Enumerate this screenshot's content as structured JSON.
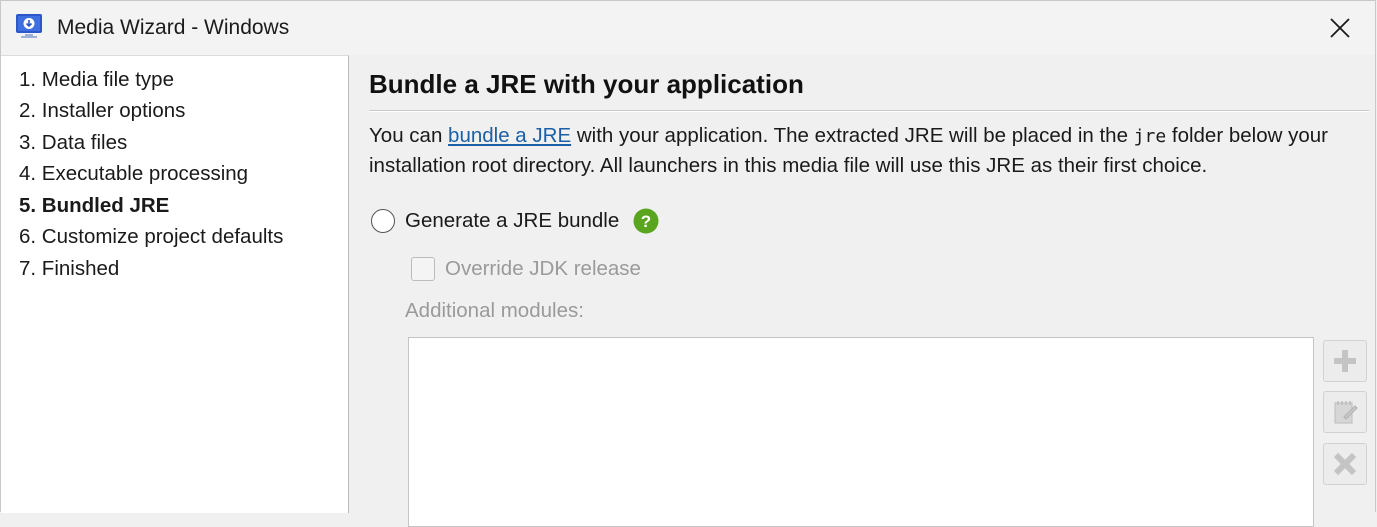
{
  "window": {
    "title": "Media Wizard - Windows",
    "app_icon": "media-wizard-icon",
    "close_icon": "close-icon"
  },
  "nav": {
    "items": [
      {
        "label": "1. Media file type",
        "active": false
      },
      {
        "label": "2. Installer options",
        "active": false
      },
      {
        "label": "3. Data files",
        "active": false
      },
      {
        "label": "4. Executable processing",
        "active": false
      },
      {
        "label": "5. Bundled JRE",
        "active": true
      },
      {
        "label": "6. Customize project defaults",
        "active": false
      },
      {
        "label": "7. Finished",
        "active": false
      }
    ]
  },
  "content": {
    "heading": "Bundle a JRE with your application",
    "description": {
      "prefix": "You can ",
      "link": "bundle a JRE",
      "middle": " with your application. The extracted JRE will be placed in the ",
      "code": "jre",
      "suffix": " folder below your installation root directory. All launchers in this media file will use this JRE as their first choice."
    },
    "generate_option": {
      "label": "Generate a JRE bundle",
      "selected": false,
      "help_icon": "help-icon"
    },
    "override_option": {
      "label": "Override JDK release",
      "checked": false,
      "enabled": false
    },
    "modules_label": "Additional modules:",
    "modules": [],
    "buttons": {
      "add_icon": "add-icon",
      "edit_icon": "edit-icon",
      "remove_icon": "remove-icon"
    }
  },
  "colors": {
    "link": "#1a5fa8",
    "help_green": "#5aa51e",
    "disabled_text": "#9a9a9a"
  }
}
